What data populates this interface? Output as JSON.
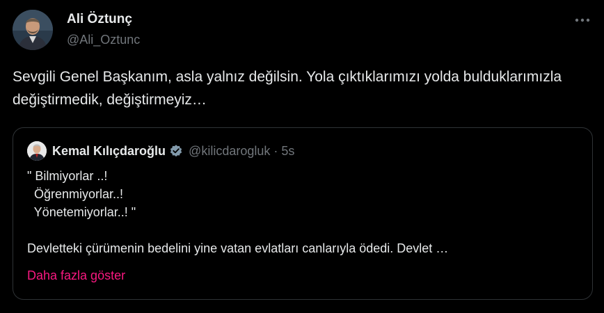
{
  "tweet": {
    "author_name": "Ali Öztunç",
    "author_handle": "@Ali_Oztunc",
    "more_icon": "more-horizontal-icon",
    "text": "Sevgili Genel Başkanım, asla yalnız değilsin. Yola çıktıklarımızı yolda bulduklarımızla değiştirmedik, değiştirmeyiz…"
  },
  "quote": {
    "author_name": "Kemal Kılıçdaroğlu",
    "verified_icon": "verified-badge-icon",
    "author_handle": "@kilicdarogluk",
    "separator": "·",
    "time": "5s",
    "lines": [
      "\" Bilmiyorlar ..!",
      "  Öğrenmiyorlar..!",
      "  Yönetemiyorlar..! \"",
      "",
      "Devletteki çürümenin bedelini yine vatan evlatları canlarıyla ödedi. Devlet …"
    ],
    "show_more": "Daha fazla göster"
  },
  "colors": {
    "background": "#000000",
    "text_primary": "#e7e9ea",
    "text_secondary": "#71767b",
    "border": "#2f3336",
    "link_pink": "#f91880",
    "verified_badge": "#829aab"
  }
}
